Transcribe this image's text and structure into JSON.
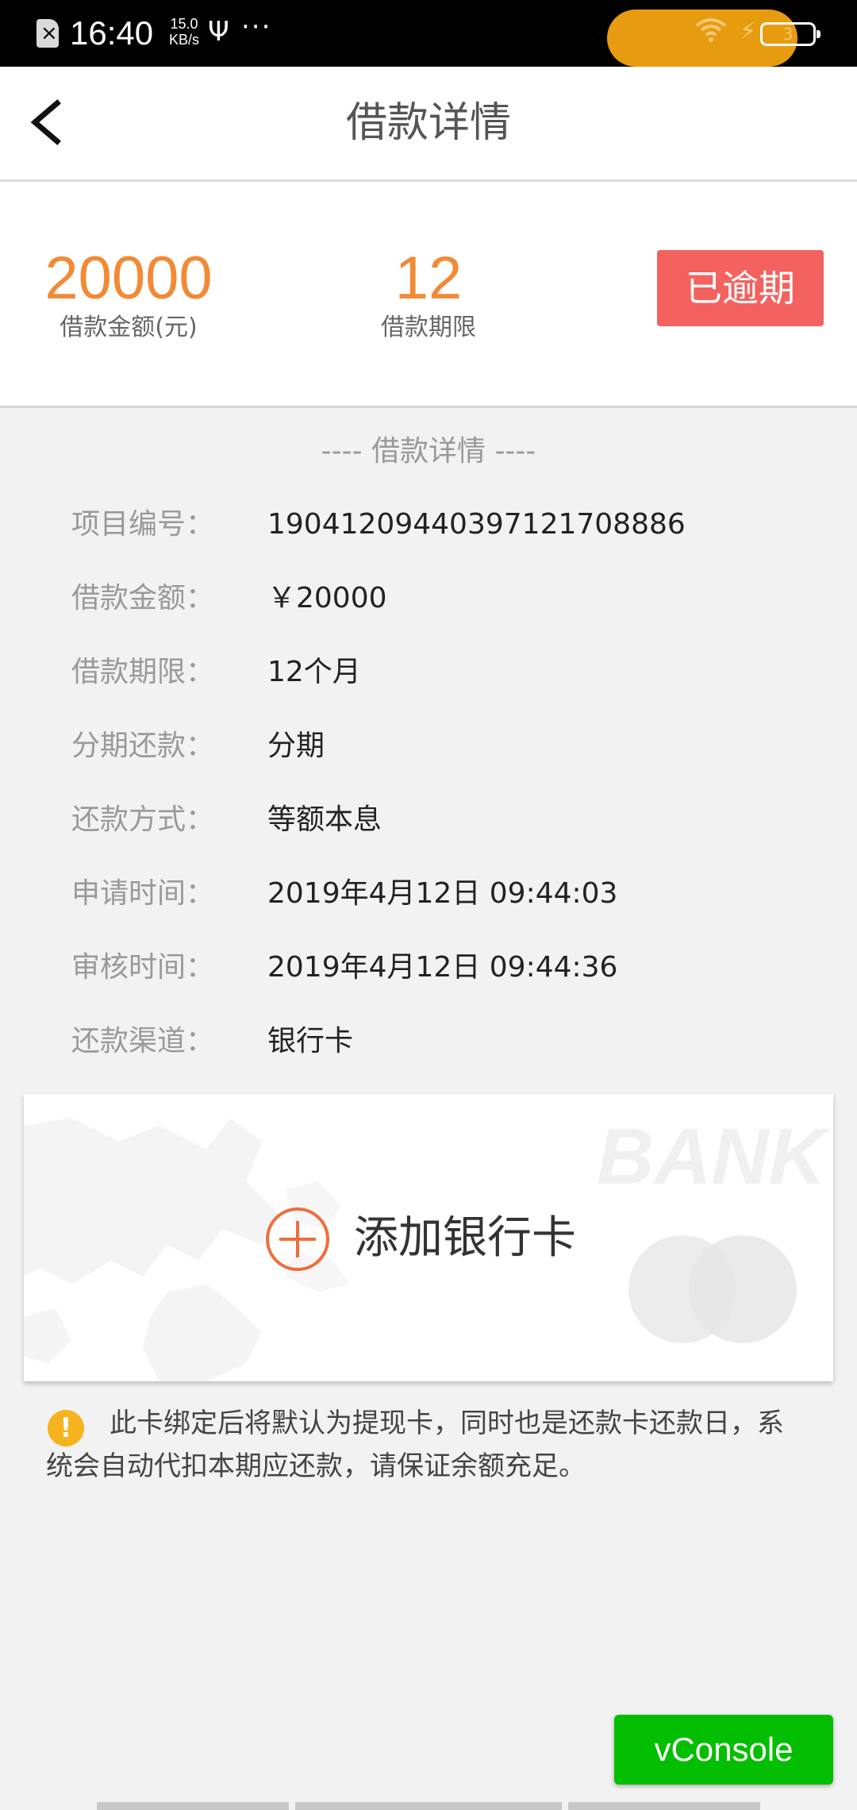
{
  "status_bar": {
    "time": "16:40",
    "net_speed_value": "15.0",
    "net_speed_unit": "KB/s",
    "usb_icon": "usb-icon",
    "more": "···",
    "battery_level": "3"
  },
  "header": {
    "title": "借款详情",
    "back_icon": "back-arrow-icon"
  },
  "summary": {
    "amount_value": "20000",
    "amount_label": "借款金额(元)",
    "term_value": "12",
    "term_label": "借款期限",
    "status": "已逾期"
  },
  "details": {
    "section_title": "---- 借款详情 ----",
    "rows": [
      {
        "label": "项目编号：",
        "value": "19041209440397121708886"
      },
      {
        "label": "借款金额：",
        "value": "￥20000"
      },
      {
        "label": "借款期限：",
        "value": "12个月"
      },
      {
        "label": "分期还款：",
        "value": "分期"
      },
      {
        "label": "还款方式：",
        "value": "等额本息"
      },
      {
        "label": "申请时间：",
        "value": "2019年4月12日 09:44:03"
      },
      {
        "label": "审核时间：",
        "value": "2019年4月12日 09:44:36"
      },
      {
        "label": "还款渠道：",
        "value": "银行卡"
      }
    ]
  },
  "bank_card": {
    "add_label": "添加银行卡",
    "watermark": "BANK"
  },
  "notice": {
    "text": "此卡绑定后将默认为提现卡，同时也是还款卡还款日，系统会自动代扣本期应还款，请保证余额充足。"
  },
  "vconsole": {
    "label": "vConsole"
  },
  "colors": {
    "accent_orange": "#f28a35",
    "overdue_red": "#f4625f",
    "vconsole_green": "#04be02",
    "warning_yellow": "#f5b31d"
  }
}
